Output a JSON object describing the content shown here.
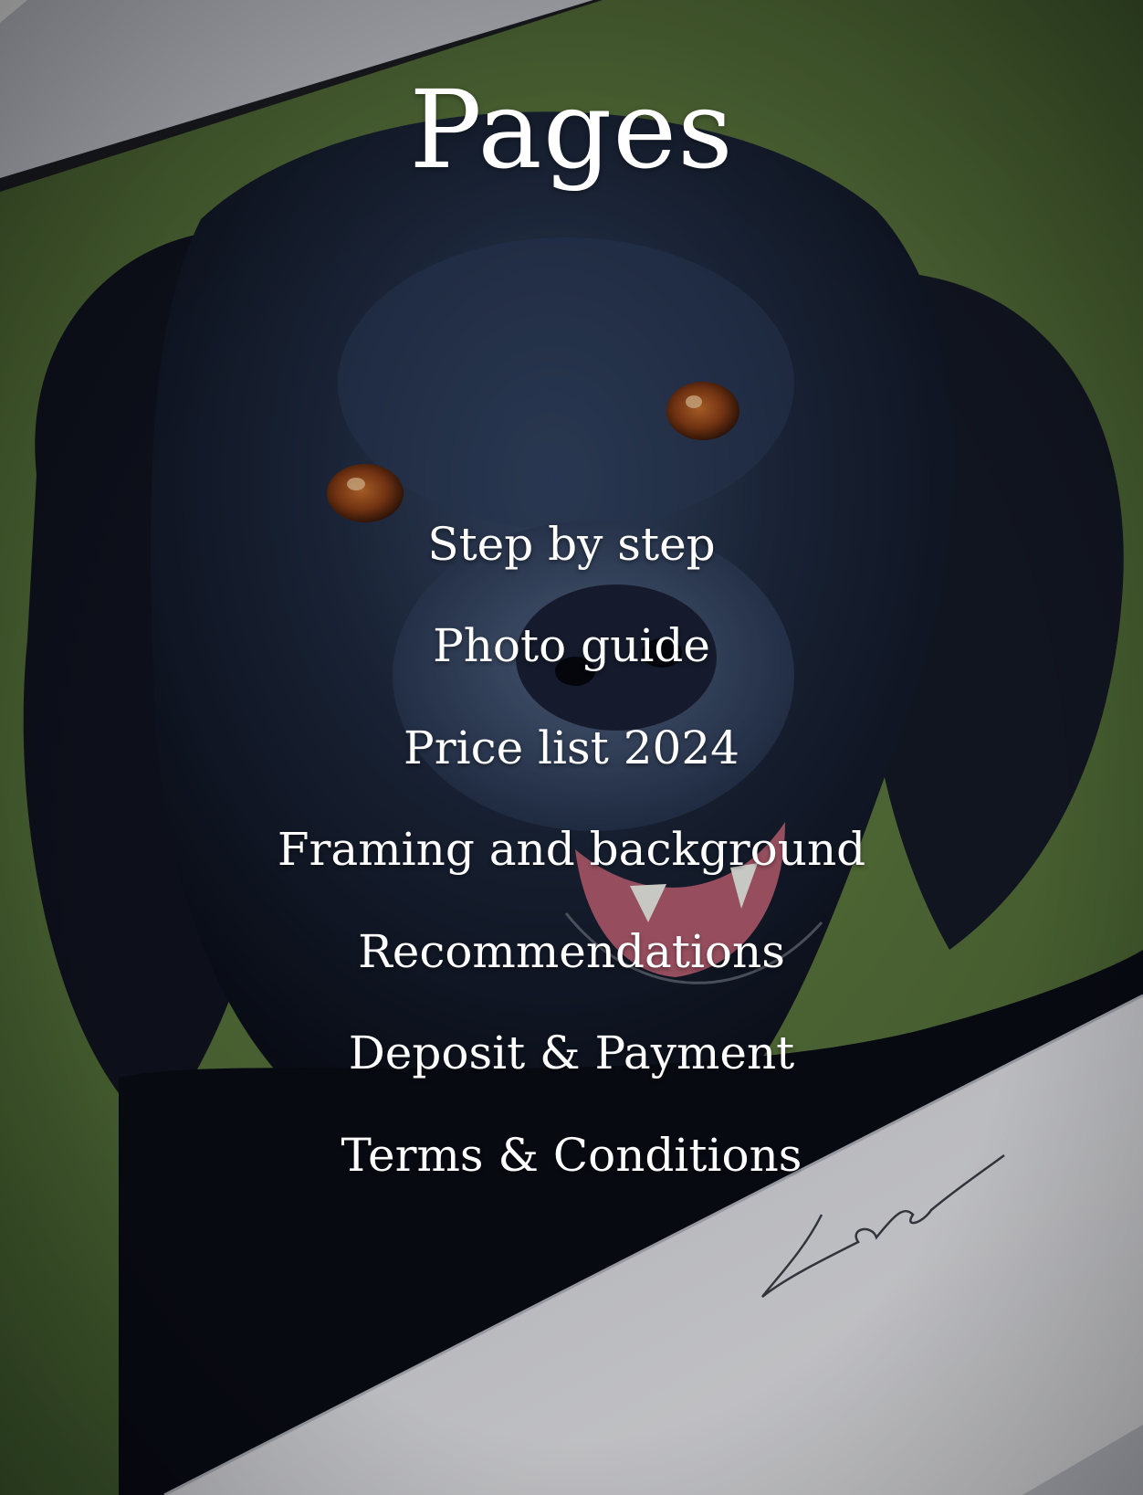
{
  "page": {
    "title": "Pages",
    "menu": [
      {
        "label": "Step by step"
      },
      {
        "label": "Photo guide"
      },
      {
        "label": "Price list 2024"
      },
      {
        "label": "Framing and background"
      },
      {
        "label": "Recommendations"
      },
      {
        "label": "Deposit & Payment"
      },
      {
        "label": "Terms & Conditions"
      }
    ],
    "background": {
      "subject": "painted portrait of a black spaniel dog",
      "signature": "Lola"
    }
  },
  "colors": {
    "text": "#ffffff",
    "painting_background": "#5d7a3e",
    "frame_mat": "#e6e6ea",
    "dog_fur": "#1a2233",
    "eye": "#9a4a1c",
    "tongue": "#b86073"
  }
}
